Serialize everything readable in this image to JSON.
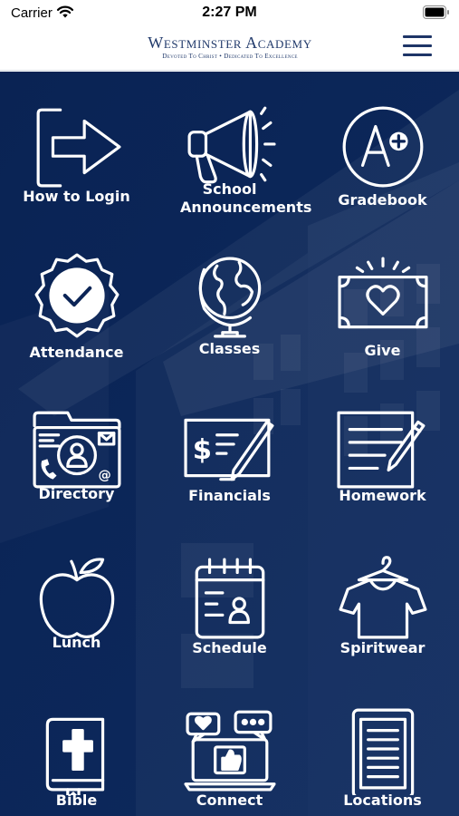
{
  "status_bar": {
    "carrier": "Carrier",
    "time": "2:27 PM",
    "icons": [
      "wifi-icon",
      "battery-icon"
    ]
  },
  "header": {
    "title": "Westminster Academy",
    "tagline": "Devoted To Christ • Dedicated To Excellence",
    "menu_icon": "hamburger-menu-icon"
  },
  "colors": {
    "background": "#0b2456",
    "header_text": "#213a6b",
    "icon_stroke": "#ffffff"
  },
  "tiles": [
    {
      "label": "How to Login",
      "icon": "login-arrow-icon"
    },
    {
      "label": "School Announcements",
      "icon": "megaphone-icon"
    },
    {
      "label": "Gradebook",
      "icon": "a-plus-grade-icon"
    },
    {
      "label": "Attendance",
      "icon": "check-badge-icon"
    },
    {
      "label": "Classes",
      "icon": "globe-icon"
    },
    {
      "label": "Give",
      "icon": "money-heart-icon"
    },
    {
      "label": "Directory",
      "icon": "contact-folder-icon"
    },
    {
      "label": "Financials",
      "icon": "check-pen-icon"
    },
    {
      "label": "Homework",
      "icon": "notepad-pencil-icon"
    },
    {
      "label": "Lunch",
      "icon": "apple-icon"
    },
    {
      "label": "Schedule",
      "icon": "calendar-person-icon"
    },
    {
      "label": "Spiritwear",
      "icon": "tshirt-hanger-icon"
    },
    {
      "label": "Bible",
      "icon": "bible-cross-icon"
    },
    {
      "label": "Connect",
      "icon": "social-laptop-icon"
    },
    {
      "label": "Locations",
      "icon": "tablet-list-icon"
    }
  ]
}
